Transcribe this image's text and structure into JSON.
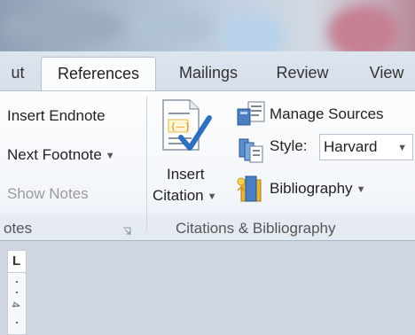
{
  "tabs": [
    {
      "label": "ut",
      "active": false
    },
    {
      "label": "References",
      "active": true
    },
    {
      "label": "Mailings",
      "active": false
    },
    {
      "label": "Review",
      "active": false
    },
    {
      "label": "View",
      "active": false
    }
  ],
  "footnotes_group": {
    "insert_endnote": "Insert Endnote",
    "next_footnote": "Next Footnote",
    "show_notes": "Show Notes",
    "label": "otes"
  },
  "citations_group": {
    "insert_citation_line1": "Insert",
    "insert_citation_line2": "Citation",
    "manage_sources": "Manage Sources",
    "style_label": "Style:",
    "style_value": "Harvard",
    "bibliography": "Bibliography",
    "label": "Citations & Bibliography"
  },
  "ruler": {
    "tab_selector": "L"
  },
  "colors": {
    "accent": "#2b579a",
    "ribbon_bg": "#f3f6fa",
    "workspace_bg": "#cfd6e1"
  }
}
